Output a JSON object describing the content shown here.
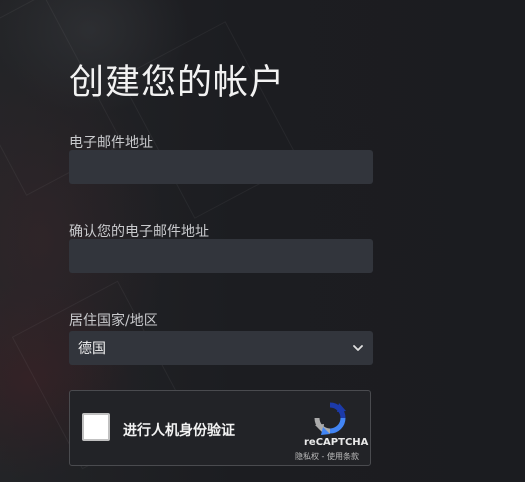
{
  "page": {
    "title": "创建您的帐户"
  },
  "form": {
    "email_label": "电子邮件地址",
    "email_value": "",
    "confirm_email_label": "确认您的电子邮件地址",
    "confirm_email_value": "",
    "country_label": "居住国家/地区",
    "country_selected": "德国"
  },
  "recaptcha": {
    "checkbox_label": "进行人机身份验证",
    "brand": "reCAPTCHA",
    "terms": "隐私权 - 使用条款",
    "checked": false
  },
  "colors": {
    "background": "#1c1d21",
    "input_background": "#32353c",
    "recaptcha_blue": "#4a90e2"
  },
  "icons": [
    "chevron-down-icon",
    "recaptcha-logo-icon"
  ]
}
